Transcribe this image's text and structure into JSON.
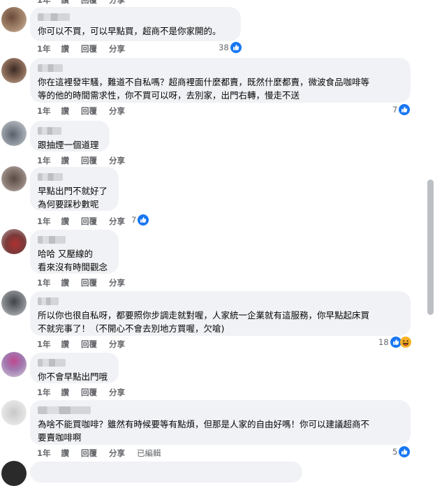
{
  "actions": {
    "time": "1年",
    "like": "讚",
    "reply": "回覆",
    "share": "分享",
    "edited": "已編輯"
  },
  "comments": [
    {
      "text": [
        "你可以不買，可以早點買，超商不是你家開的。"
      ],
      "reactions": "38",
      "reaction_icons": [
        "like-icon"
      ]
    },
    {
      "text": [
        "你在這裡發牢騷，難道不自私嗎？超商裡面什麼都賣，既然什麼都賣，微波食品咖啡等",
        "等的他的時間需求性，你不買可以呀，去別家，出門右轉，慢走不送"
      ],
      "reactions": "7",
      "reaction_icons": [
        "like-icon"
      ]
    },
    {
      "text": [
        "跟抽煙一個道理"
      ],
      "reactions": "",
      "reaction_icons": []
    },
    {
      "text": [
        "早點出門不就好了",
        "為何要踩秒數呢"
      ],
      "reactions": "7",
      "reaction_icons": [
        "like-icon"
      ]
    },
    {
      "text": [
        "哈哈 又壓線的",
        "看來沒有時間觀念"
      ],
      "reactions": "",
      "reaction_icons": []
    },
    {
      "text": [
        "所以你也很自私呀，都要照你步調走就對喔，人家統一企業就有這服務，你早點起床買",
        "不就完事了！（不開心不會去別地方買喔，欠嗆)"
      ],
      "reactions": "18",
      "reaction_icons": [
        "like-icon",
        "haha-icon"
      ]
    },
    {
      "text": [
        "你不會早點出門哦"
      ],
      "reactions": "",
      "reaction_icons": []
    },
    {
      "text": [
        "為啥不能買咖啡？雖然有時候要等有點煩，但那是人家的自由好嗎！你可以建議超商不",
        "要賣咖啡啊"
      ],
      "reactions": "5",
      "reaction_icons": [
        "like-icon"
      ]
    }
  ],
  "colors": {
    "bubble": "#f0f2f5",
    "like_blue": "#1877f2",
    "haha_yellow": "#f7b125",
    "meta_gray": "#65676b"
  }
}
